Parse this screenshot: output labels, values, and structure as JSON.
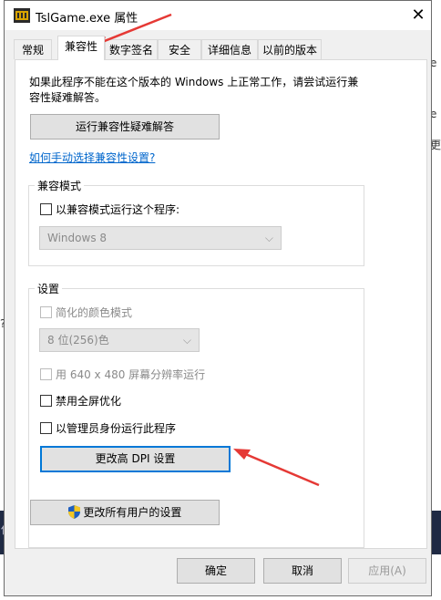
{
  "window": {
    "title": "TslGame.exe 属性",
    "close_glyph": "✕"
  },
  "tabs": [
    {
      "label": "常规"
    },
    {
      "label": "兼容性"
    },
    {
      "label": "数字签名"
    },
    {
      "label": "安全"
    },
    {
      "label": "详细信息"
    },
    {
      "label": "以前的版本"
    }
  ],
  "active_tab": "兼容性",
  "intro": {
    "line1": "如果此程序不能在这个版本的 Windows 上正常工作，请尝试运行兼",
    "line2": "容性疑难解答。"
  },
  "troubleshooter_button": "运行兼容性疑难解答",
  "manual_link": "如何手动选择兼容性设置?",
  "compat_mode": {
    "group_label": "兼容模式",
    "checkbox_label": "以兼容模式运行这个程序:",
    "os_select_value": "Windows 8"
  },
  "settings": {
    "group_label": "设置",
    "reduced_color_label": "简化的颜色模式",
    "color_select_value": "8 位(256)色",
    "low_res_label": "用 640 x 480 屏幕分辨率运行",
    "disable_fullscreen_label": "禁用全屏优化",
    "run_as_admin_label": "以管理员身份运行此程序",
    "high_dpi_button": "更改高 DPI 设置"
  },
  "all_users_button": "更改所有用户的设置",
  "footer": {
    "ok": "确定",
    "cancel": "取消",
    "apply": "应用(A)"
  },
  "background": {
    "right_chars": [
      "e",
      "e",
      "更"
    ],
    "left_char": "?",
    "bottom_char": "保"
  },
  "colors": {
    "annotation_arrow": "#e53935",
    "link": "#0066cc",
    "focus": "#0078d7"
  }
}
